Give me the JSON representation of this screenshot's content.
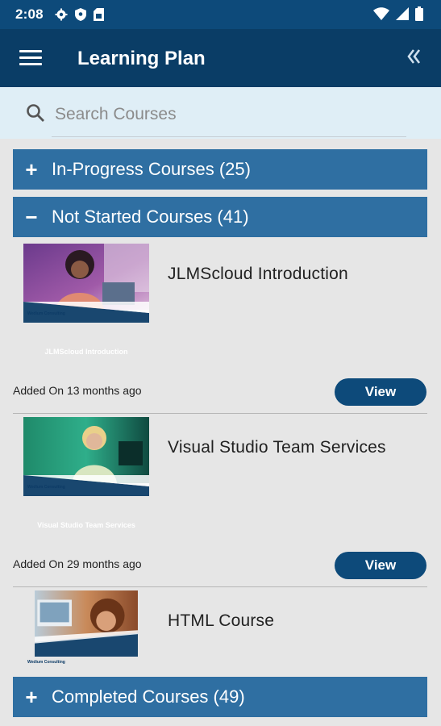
{
  "status_bar": {
    "time": "2:08",
    "icons": [
      "settings-icon",
      "shield-icon",
      "sim-card-icon"
    ],
    "right_icons": [
      "wifi-icon",
      "signal-icon",
      "battery-icon"
    ]
  },
  "app_bar": {
    "title": "Learning Plan",
    "menu_icon": "menu-icon",
    "collapse_icon": "double-chevron-left-icon"
  },
  "search": {
    "placeholder": "Search Courses",
    "value": ""
  },
  "sections": [
    {
      "label": "In-Progress Courses (25)",
      "expanded": false,
      "symbol": "+"
    },
    {
      "label": "Not Started Courses (41)",
      "expanded": true,
      "symbol": "−"
    },
    {
      "label": "Completed Courses (49)",
      "expanded": false,
      "symbol": "+"
    }
  ],
  "courses": [
    {
      "title": "JLMScloud Introduction",
      "thumbnail_text": "JLMScloud Introduction",
      "added": "Added On 13 months ago",
      "view_label": "View"
    },
    {
      "title": "Visual Studio Team Services",
      "thumbnail_text": "Visual Studio Team Services",
      "added": "Added On 29 months ago",
      "view_label": "View"
    },
    {
      "title": "HTML Course",
      "thumbnail_text": "",
      "added": "",
      "view_label": ""
    }
  ],
  "thumbnail_brand": "Wedium Consulting",
  "colors": {
    "status_bar": "#0d4a7a",
    "app_bar": "#0a3d66",
    "section_header": "#2f6fa2",
    "button": "#0d4a7a",
    "search_bg": "#dfeef6"
  }
}
